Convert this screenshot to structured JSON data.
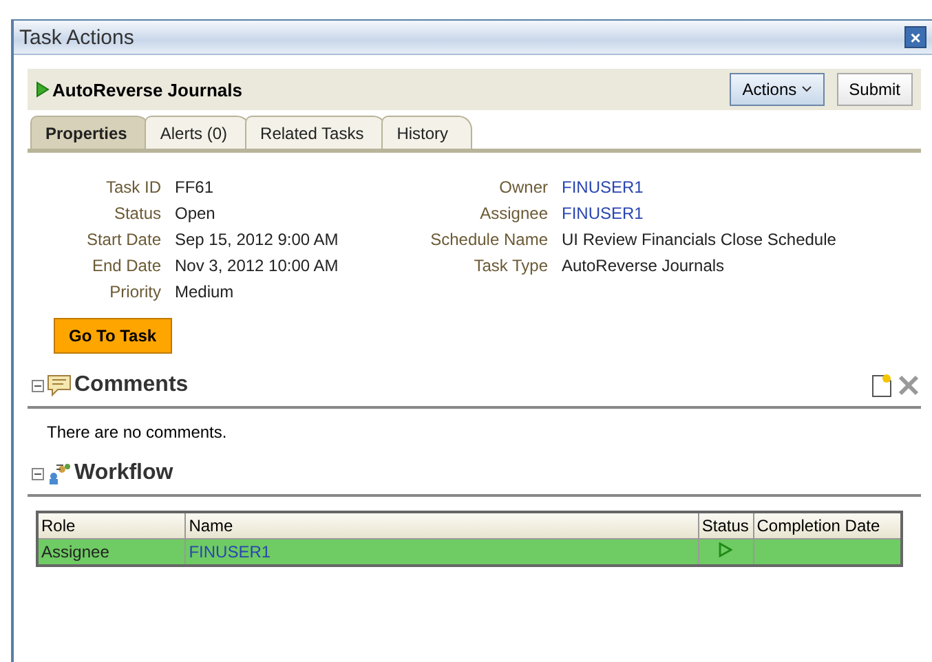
{
  "window": {
    "title": "Task Actions",
    "close": "×"
  },
  "header": {
    "title": "AutoReverse Journals",
    "buttons": [
      {
        "label": "Actions",
        "kind": "menu"
      },
      {
        "label": "Submit",
        "kind": "plain"
      }
    ]
  },
  "tabs": [
    {
      "label": "Properties",
      "selected": true
    },
    {
      "label": "Alerts (0)",
      "selected": false
    },
    {
      "label": "Related Tasks",
      "selected": false
    },
    {
      "label": "History",
      "selected": false
    }
  ],
  "properties": {
    "left": [
      {
        "label": "Task ID",
        "value": "FF61",
        "link": false
      },
      {
        "label": "Status",
        "value": "Open",
        "link": false
      },
      {
        "label": "Start Date",
        "value": "Sep 15, 2012 9:00 AM",
        "link": false
      },
      {
        "label": "End Date",
        "value": "Nov 3, 2012 10:00 AM",
        "link": false
      },
      {
        "label": "Priority",
        "value": "Medium",
        "link": false
      }
    ],
    "right": [
      {
        "label": "Owner",
        "value": "FINUSER1",
        "link": true
      },
      {
        "label": "Assignee",
        "value": "FINUSER1",
        "link": true
      },
      {
        "label": "Schedule Name",
        "value": "UI Review Financials Close Schedule",
        "link": false
      },
      {
        "label": "Task Type",
        "value": "AutoReverse Journals",
        "link": false
      }
    ]
  },
  "go_button": "Go To Task",
  "comments": {
    "title": "Comments",
    "expanded": true,
    "message": "There are no comments."
  },
  "workflow": {
    "title": "Workflow",
    "expanded": true,
    "columns": [
      "Role",
      "Name",
      "Status",
      "Completion Date"
    ],
    "rows": [
      {
        "role": "Assignee",
        "name": "FINUSER1",
        "completion_date": "",
        "selected": true
      }
    ]
  }
}
